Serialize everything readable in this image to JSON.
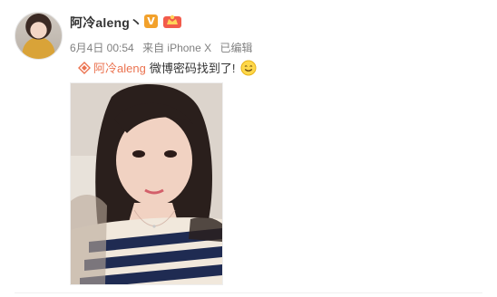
{
  "post": {
    "username": "阿冷aleng丶",
    "date": "6月4日 00:54",
    "source": "来自 iPhone X",
    "edited": "已编辑",
    "mention": "阿冷aleng",
    "text": "微博密码找到了!"
  },
  "badges": {
    "vip": "V",
    "vip_color": "#f2a12b",
    "level_color": "#f25b4b"
  },
  "colors": {
    "mention": "#eb7350",
    "meta": "#808080"
  },
  "icons": [
    "verified-badge-icon",
    "level-crown-icon",
    "diamond-icon",
    "smile-emoji-icon"
  ]
}
